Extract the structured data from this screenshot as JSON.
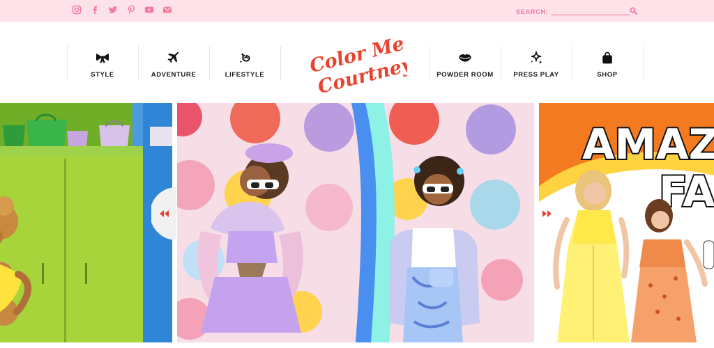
{
  "topbar": {
    "social": [
      "instagram-icon",
      "facebook-icon",
      "twitter-icon",
      "pinterest-icon",
      "youtube-icon",
      "email-icon"
    ],
    "social_color": "#f27aa0",
    "search_label": "SEARCH:",
    "search_value": "",
    "search_placeholder": ""
  },
  "nav": {
    "left": [
      {
        "label": "STYLE",
        "icon": "bow-icon"
      },
      {
        "label": "ADVENTURE",
        "icon": "airplane-icon"
      },
      {
        "label": "LIFESTYLE",
        "icon": "sparkle-swirl-icon"
      }
    ],
    "right": [
      {
        "label": "POWDER ROOM",
        "icon": "lips-icon"
      },
      {
        "label": "PRESS PLAY",
        "icon": "sparkles-icon"
      },
      {
        "label": "SHOP",
        "icon": "shopping-bag-icon"
      }
    ],
    "logo": {
      "line1": "Color Me",
      "line2": "Courtney",
      "color": "#e8432e"
    }
  },
  "carousel": {
    "slides": [
      {
        "name": "slide-purses-closet"
      },
      {
        "name": "slide-pastel-outfits"
      },
      {
        "name": "slide-amazon-fashion",
        "overlay_text_line1": "AMAZ",
        "overlay_text_line2": "FA"
      }
    ],
    "prev_label": "previous",
    "next_label": "next",
    "arrow_color": "#e8432e"
  }
}
